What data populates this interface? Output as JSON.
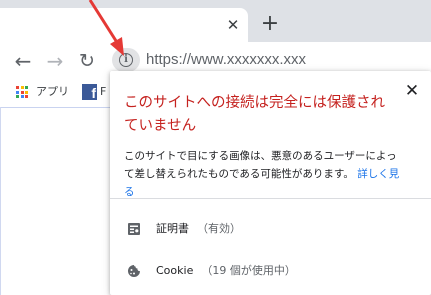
{
  "tab": {
    "close_glyph": "✕",
    "new_tab_glyph": "+"
  },
  "toolbar": {
    "back_glyph": "←",
    "forward_glyph": "→",
    "reload_glyph": "↻",
    "site_info_glyph": "i",
    "url": "https://www.xxxxxxx.xxx"
  },
  "bookmarks": {
    "apps_label": "アプリ",
    "facebook_glyph": "f",
    "facebook_text": "F"
  },
  "site_info_popup": {
    "close_glyph": "✕",
    "title": "このサイトへの接続は完全には保護されていません",
    "description": "このサイトで目にする画像は、悪意のあるユーザーによって差し替えられたものである可能性があります。",
    "learn_more_link": "詳しく見る",
    "certificate": {
      "label": "証明書",
      "status": "（有効）",
      "icon": "certificate-icon"
    },
    "cookie": {
      "label": "Cookie",
      "status": "（19 個が使用中）",
      "icon": "cookie-icon"
    }
  },
  "colors": {
    "warning_text": "#c5221f",
    "link": "#1a73e8",
    "annotation_arrow": "#e53935",
    "titlebar": "#dee1e6"
  }
}
